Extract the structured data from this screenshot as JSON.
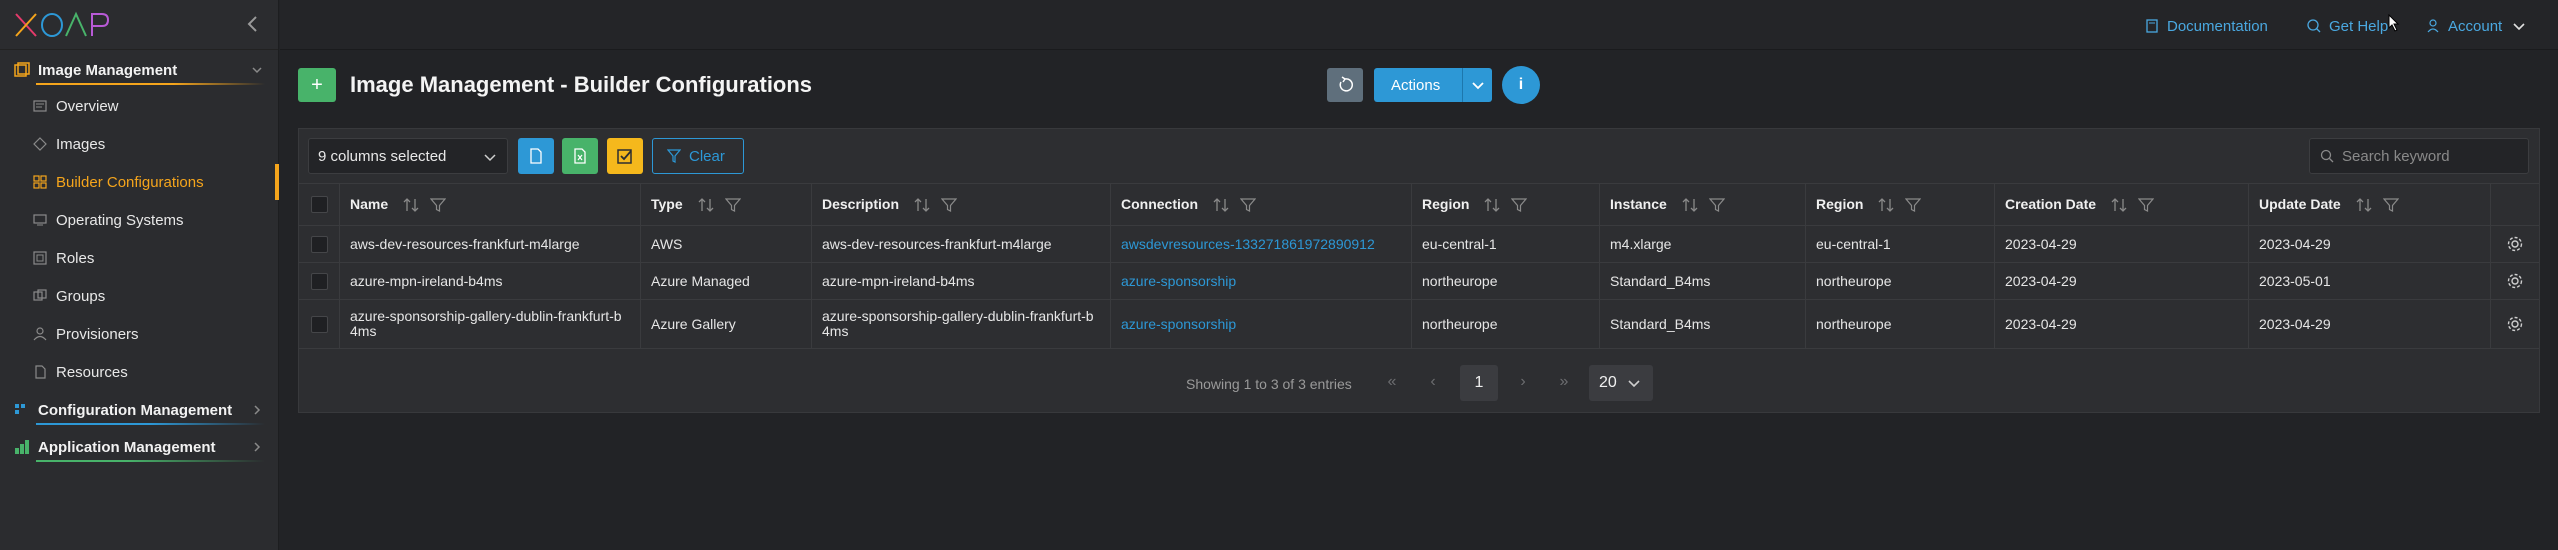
{
  "brand": {
    "logo_text": "XOAP"
  },
  "sidebar": {
    "groups": [
      {
        "label": "Image Management",
        "icon": "image-management-icon",
        "accent": "#f5a51c"
      },
      {
        "label": "Configuration Management",
        "icon": "configuration-management-icon",
        "accent": "#2d98d6"
      },
      {
        "label": "Application Management",
        "icon": "application-management-icon",
        "accent": "#48b36a"
      }
    ],
    "items": [
      {
        "label": "Overview",
        "icon": "overview-icon"
      },
      {
        "label": "Images",
        "icon": "images-icon"
      },
      {
        "label": "Builder Configurations",
        "icon": "builder-configurations-icon",
        "active": true
      },
      {
        "label": "Operating Systems",
        "icon": "operating-systems-icon"
      },
      {
        "label": "Roles",
        "icon": "roles-icon"
      },
      {
        "label": "Groups",
        "icon": "groups-icon"
      },
      {
        "label": "Provisioners",
        "icon": "provisioners-icon"
      },
      {
        "label": "Resources",
        "icon": "resources-icon"
      }
    ]
  },
  "topbar": {
    "documentation": "Documentation",
    "get_help": "Get Help",
    "account": "Account"
  },
  "page": {
    "title": "Image Management - Builder Configurations",
    "actions_label": "Actions",
    "info_label": "i"
  },
  "toolbar": {
    "columns_selected": "9 columns selected",
    "clear_label": "Clear",
    "search_placeholder": "Search keyword"
  },
  "table": {
    "columns": [
      "Name",
      "Type",
      "Description",
      "Connection",
      "Region",
      "Instance",
      "Region",
      "Creation Date",
      "Update Date"
    ],
    "rows": [
      {
        "name": "aws-dev-resources-frankfurt-m4large",
        "type": "AWS",
        "description": "aws-dev-resources-frankfurt-m4large",
        "connection": "awsdevresources-133271861972890912",
        "region": "eu-central-1",
        "instance": "m4.xlarge",
        "region2": "eu-central-1",
        "created": "2023-04-29",
        "updated": "2023-04-29"
      },
      {
        "name": "azure-mpn-ireland-b4ms",
        "type": "Azure Managed",
        "description": "azure-mpn-ireland-b4ms",
        "connection": "azure-sponsorship",
        "region": "northeurope",
        "instance": "Standard_B4ms",
        "region2": "northeurope",
        "created": "2023-04-29",
        "updated": "2023-05-01"
      },
      {
        "name": "azure-sponsorship-gallery-dublin-frankfurt-b4ms",
        "name_lines": [
          "azure-sponsorship-gallery-dublin-frankfurt-b",
          "4ms"
        ],
        "type": "Azure Gallery",
        "description": "azure-sponsorship-gallery-dublin-frankfurt-b4ms",
        "description_lines": [
          "azure-sponsorship-gallery-dublin-frankfurt-b",
          "4ms"
        ],
        "connection": "azure-sponsorship",
        "region": "northeurope",
        "instance": "Standard_B4ms",
        "region2": "northeurope",
        "created": "2023-04-29",
        "updated": "2023-04-29"
      }
    ]
  },
  "pagination": {
    "info": "Showing 1 to 3 of 3 entries",
    "current_page": "1",
    "page_size": "20"
  },
  "colors": {
    "accent_orange": "#f5a51c",
    "accent_blue": "#2d98d6",
    "accent_green": "#48b36a",
    "accent_yellow": "#f5b81c"
  }
}
